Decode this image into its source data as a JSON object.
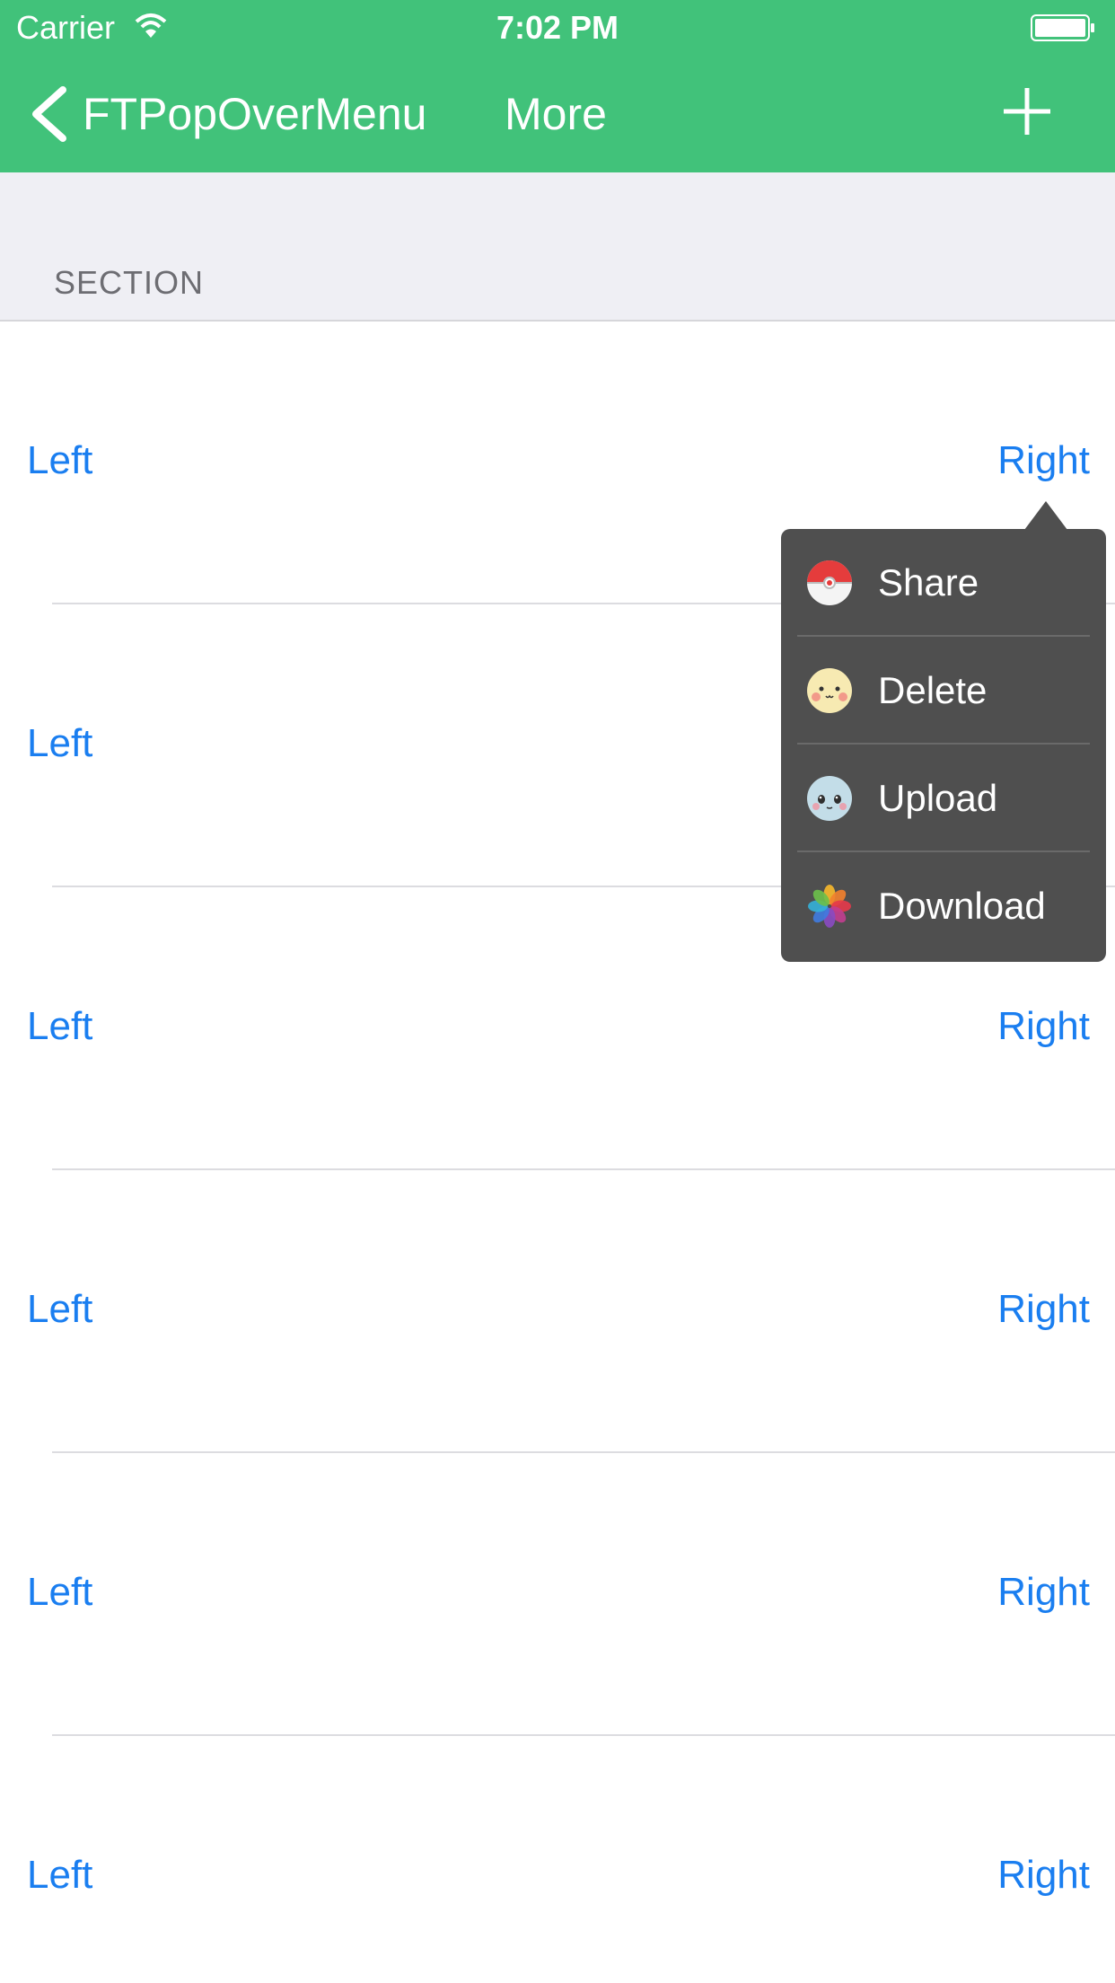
{
  "status_bar": {
    "carrier": "Carrier",
    "time": "7:02 PM"
  },
  "navbar": {
    "back_label": "FTPopOverMenu",
    "title": "More",
    "color": "#41c27a"
  },
  "section": {
    "header": "SECTION"
  },
  "rows": [
    {
      "left": "Left",
      "right": "Right"
    },
    {
      "left": "Left",
      "right": ""
    },
    {
      "left": "Left",
      "right": "Right"
    },
    {
      "left": "Left",
      "right": "Right"
    },
    {
      "left": "Left",
      "right": "Right"
    },
    {
      "left": "Left",
      "right": "Right"
    }
  ],
  "popover_menu": {
    "items": [
      {
        "label": "Share",
        "icon": "pokeball-icon"
      },
      {
        "label": "Delete",
        "icon": "pikachu-face-icon"
      },
      {
        "label": "Upload",
        "icon": "squirtle-face-icon"
      },
      {
        "label": "Download",
        "icon": "photos-flower-icon"
      }
    ],
    "background": "#4f4f4f"
  },
  "link_color": "#1a7ef0"
}
